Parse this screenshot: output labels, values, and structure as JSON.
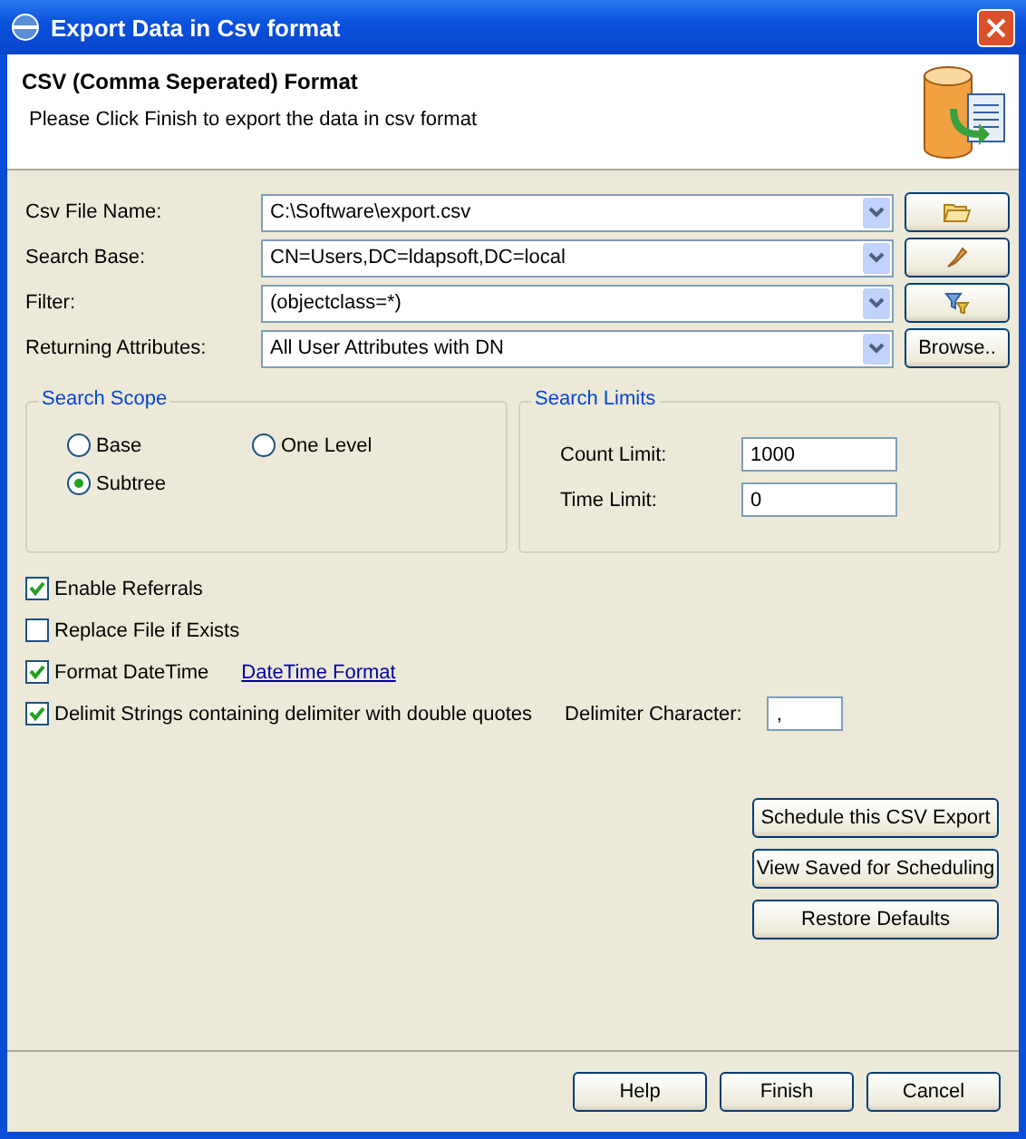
{
  "window": {
    "title": "Export Data in Csv format"
  },
  "header": {
    "title": "CSV (Comma Seperated) Format",
    "description": "Please Click Finish to export the data in csv format"
  },
  "fields": [
    {
      "label": "Csv File Name:",
      "value": "C:\\Software\\export.csv",
      "button": {
        "kind": "folder"
      }
    },
    {
      "label": "Search Base:",
      "value": "CN=Users,DC=ldapsoft,DC=local",
      "button": {
        "kind": "pick"
      }
    },
    {
      "label": "Filter:",
      "value": "(objectclass=*)",
      "button": {
        "kind": "filter"
      }
    },
    {
      "label": "Returning Attributes:",
      "value": "All User Attributes with DN",
      "button": {
        "kind": "text",
        "label": "Browse.."
      }
    }
  ],
  "search_scope": {
    "title": "Search Scope",
    "options": [
      {
        "label": "Base",
        "selected": false
      },
      {
        "label": "One Level",
        "selected": false
      },
      {
        "label": "Subtree",
        "selected": true
      }
    ]
  },
  "search_limits": {
    "title": "Search Limits",
    "fields": [
      {
        "label": "Count Limit:",
        "value": "1000"
      },
      {
        "label": "Time Limit:",
        "value": "0"
      }
    ]
  },
  "options": [
    {
      "label": "Enable Referrals",
      "checked": true
    },
    {
      "label": "Replace File if Exists",
      "checked": false
    },
    {
      "label": "Format DateTime",
      "checked": true,
      "link": "DateTime Format"
    },
    {
      "label": "Delimit Strings containing delimiter with double quotes",
      "checked": true,
      "field": {
        "label": "Delimiter Character:",
        "value": ","
      }
    }
  ],
  "side_buttons": [
    "Schedule this CSV Export",
    "View Saved for Scheduling",
    "Restore Defaults"
  ],
  "buttons": [
    "Help",
    "Finish",
    "Cancel"
  ]
}
